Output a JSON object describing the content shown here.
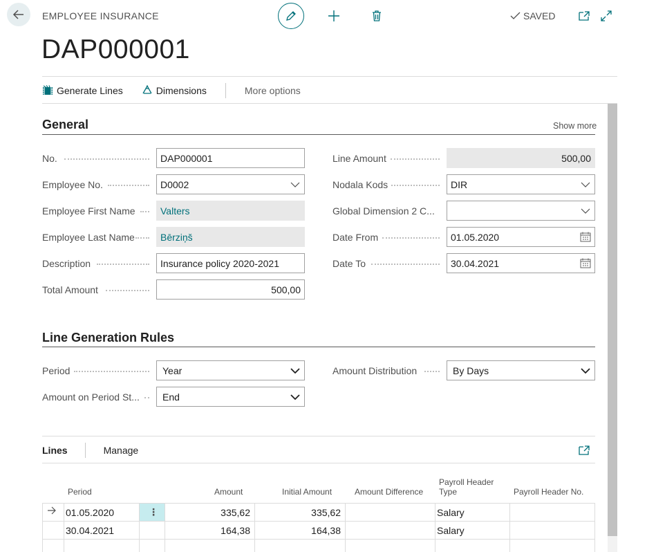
{
  "header": {
    "caption": "EMPLOYEE INSURANCE",
    "saved_label": "SAVED",
    "title": "DAP000001"
  },
  "actions": {
    "generate_lines": "Generate Lines",
    "dimensions": "Dimensions",
    "more_options": "More options"
  },
  "general": {
    "title": "General",
    "show_more": "Show more",
    "no_label": "No.",
    "no_value": "DAP000001",
    "employee_no_label": "Employee No.",
    "employee_no_value": "D0002",
    "first_name_label": "Employee First Name",
    "first_name_value": "Valters",
    "last_name_label": "Employee Last Name",
    "last_name_value": "Bērziņš",
    "description_label": "Description",
    "description_value": "Insurance policy 2020-2021",
    "total_amount_label": "Total Amount",
    "total_amount_value": "500,00",
    "line_amount_label": "Line Amount",
    "line_amount_value": "500,00",
    "nodala_label": "Nodala Kods",
    "nodala_value": "DIR",
    "gdim2_label": "Global Dimension 2 C...",
    "gdim2_value": "",
    "date_from_label": "Date From",
    "date_from_value": "01.05.2020",
    "date_to_label": "Date To",
    "date_to_value": "30.04.2021"
  },
  "rules": {
    "title": "Line Generation Rules",
    "period_label": "Period",
    "period_value": "Year",
    "amount_on_label": "Amount on Period St...",
    "amount_on_value": "End",
    "distribution_label": "Amount Distribution",
    "distribution_value": "By Days"
  },
  "lines": {
    "tab": "Lines",
    "manage": "Manage",
    "columns": {
      "period": "Period",
      "amount": "Amount",
      "initial_amount": "Initial Amount",
      "amount_difference": "Amount Difference",
      "payroll_type_1": "Payroll Header",
      "payroll_type_2": "Type",
      "payroll_no": "Payroll Header No."
    },
    "rows": [
      {
        "period": "01.05.2020",
        "amount": "335,62",
        "initial": "335,62",
        "difference": "",
        "type": "Salary",
        "payroll_no": ""
      },
      {
        "period": "30.04.2021",
        "amount": "164,38",
        "initial": "164,38",
        "difference": "",
        "type": "Salary",
        "payroll_no": ""
      }
    ]
  },
  "colors": {
    "accent": "#00707a",
    "selected_cell": "#c6ecef"
  }
}
